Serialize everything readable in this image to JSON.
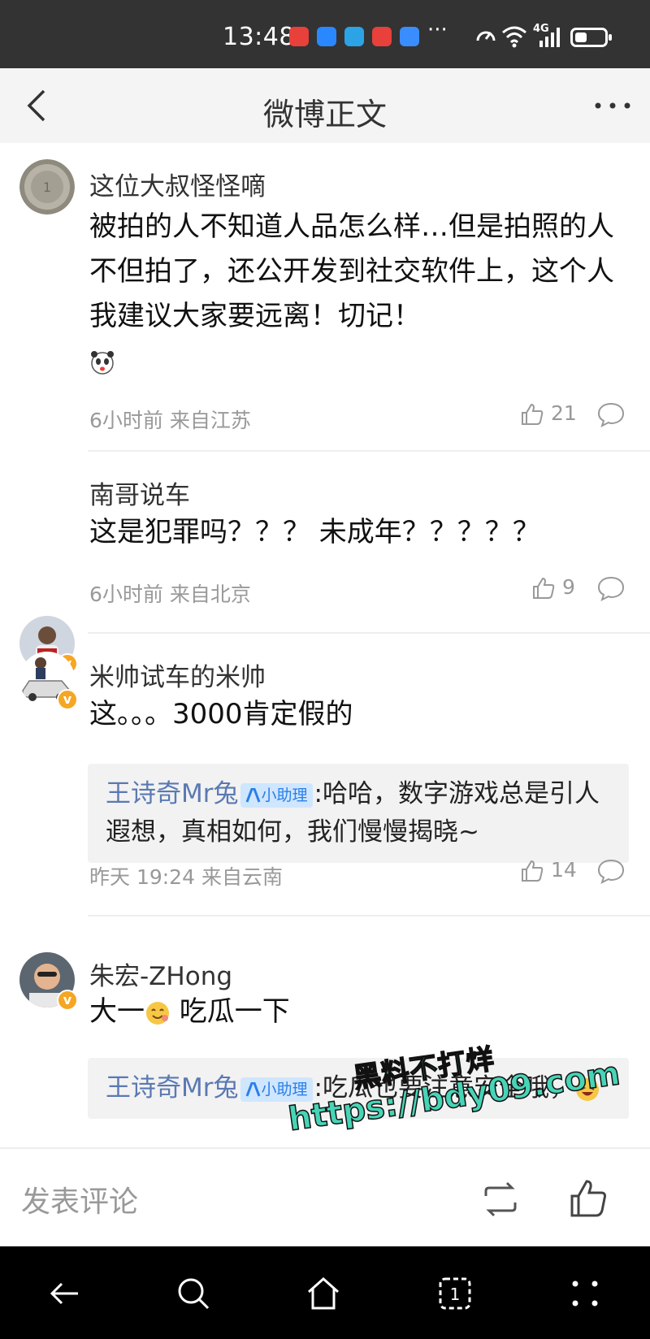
{
  "status_bar": {
    "time": "13:48",
    "more_notifications": "···",
    "network": "4G",
    "battery_level": 0.4
  },
  "header": {
    "title": "微博正文"
  },
  "comments": [
    {
      "username": "这位大叔怪怪嘀",
      "text": "被拍的人不知道人品怎么样…但是拍照的人不但拍了，还公开发到社交软件上，这个人我建议大家要远离！切记！",
      "time": "6小时前",
      "location": "来自江苏",
      "likes": "21",
      "verified": false
    },
    {
      "username": "南哥说车",
      "text": "这是犯罪吗？？？ 未成年？？？？？",
      "time": "6小时前",
      "location": "来自北京",
      "likes": "9",
      "verified": true
    },
    {
      "username": "米帅试车的米帅",
      "text": "这。。。3000肯定假的",
      "reply": {
        "author": "王诗奇Mr兔",
        "badge": "小助理",
        "text": ":哈哈，数字游戏总是引人遐想，真相如何，我们慢慢揭晓~"
      },
      "time": "昨天 19:24",
      "location": "来自云南",
      "likes": "14",
      "verified": true
    },
    {
      "username": "朱宏-ZHong",
      "text_before": "大一",
      "text_after": " 吃瓜一下",
      "reply": {
        "author": "王诗奇Mr兔",
        "badge": "小助理",
        "text": ":吃瓜也要注意安全哦，"
      },
      "verified": true
    }
  ],
  "watermark": {
    "line1": "黑料不打烊",
    "line2": "https://bdy09.com"
  },
  "input_bar": {
    "placeholder": "发表评论"
  }
}
